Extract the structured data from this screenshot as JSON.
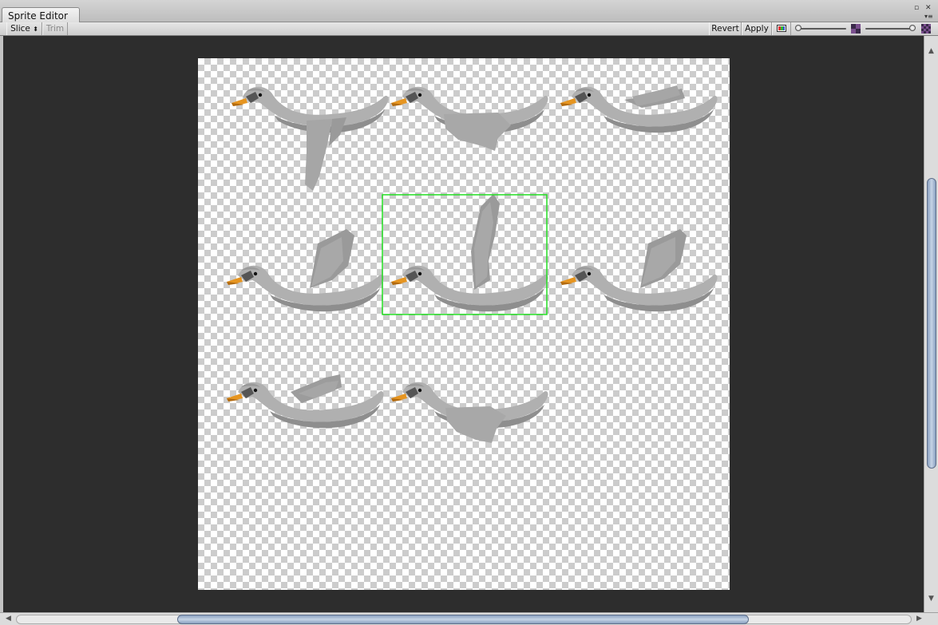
{
  "window": {
    "tab_title": "Sprite Editor",
    "maximize_icon": "▫",
    "close_icon": "✕",
    "menu_icon": "▾≡"
  },
  "toolbar": {
    "slice_label": "Slice",
    "slice_icon": "⬍",
    "trim_label": "Trim",
    "revert_label": "Revert",
    "apply_label": "Apply",
    "zoom_slider_value": 0.0,
    "mip_slider_value": 1.0
  },
  "colors": {
    "selection": "#22dd22",
    "canvas_bg": "#2d2d2d",
    "swan_body": "#b4b4b4",
    "swan_shadow": "#9a9a9a",
    "beak": "#e69520"
  },
  "sprites": [
    {
      "pose": "wing-down"
    },
    {
      "pose": "wing-mid-low"
    },
    {
      "pose": "wing-flat"
    },
    {
      "pose": "wing-up"
    },
    {
      "pose": "wing-high",
      "selected": true
    },
    {
      "pose": "wing-up"
    },
    {
      "pose": "wing-flat"
    },
    {
      "pose": "wing-mid-low"
    }
  ],
  "scrollbars": {
    "vertical_position": 0.5,
    "horizontal_position": 0.5
  }
}
